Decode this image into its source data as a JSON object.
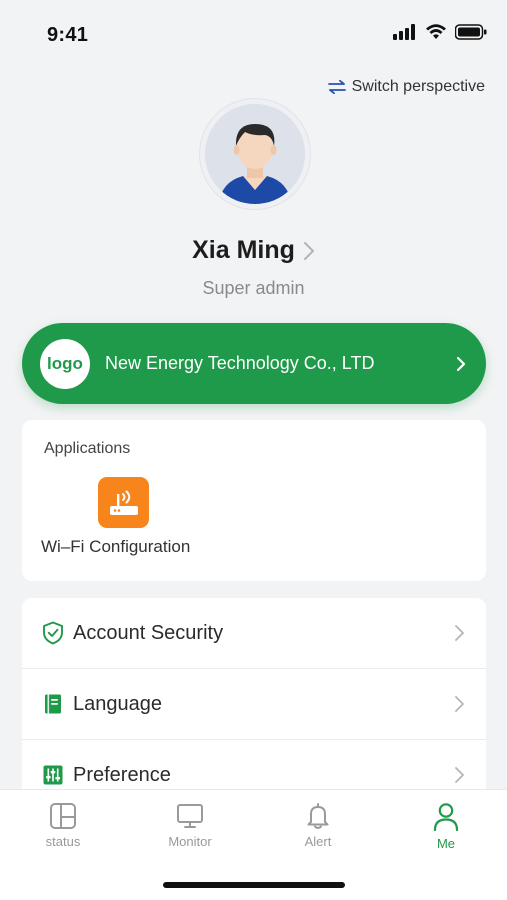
{
  "status_bar": {
    "time": "9:41"
  },
  "header": {
    "switch_label": "Switch perspective"
  },
  "profile": {
    "name": "Xia Ming",
    "role": "Super admin"
  },
  "company": {
    "logo_text": "logo",
    "name": "New Energy Technology Co., LTD"
  },
  "applications": {
    "title": "Applications",
    "items": [
      {
        "label": "Wi–Fi Configuration",
        "icon": "router-wifi-icon"
      }
    ]
  },
  "menu": {
    "items": [
      {
        "label": "Account Security",
        "icon": "shield-check-icon"
      },
      {
        "label": "Language",
        "icon": "book-icon"
      },
      {
        "label": "Preference",
        "icon": "sliders-icon"
      }
    ]
  },
  "tabs": [
    {
      "label": "status",
      "icon": "dashboard-icon",
      "active": false
    },
    {
      "label": "Monitor",
      "icon": "monitor-icon",
      "active": false
    },
    {
      "label": "Alert",
      "icon": "bell-icon",
      "active": false
    },
    {
      "label": "Me",
      "icon": "person-icon",
      "active": true
    }
  ],
  "colors": {
    "primary": "#1f9a4a",
    "app_orange": "#f7851b",
    "background": "#f2f3f5"
  }
}
